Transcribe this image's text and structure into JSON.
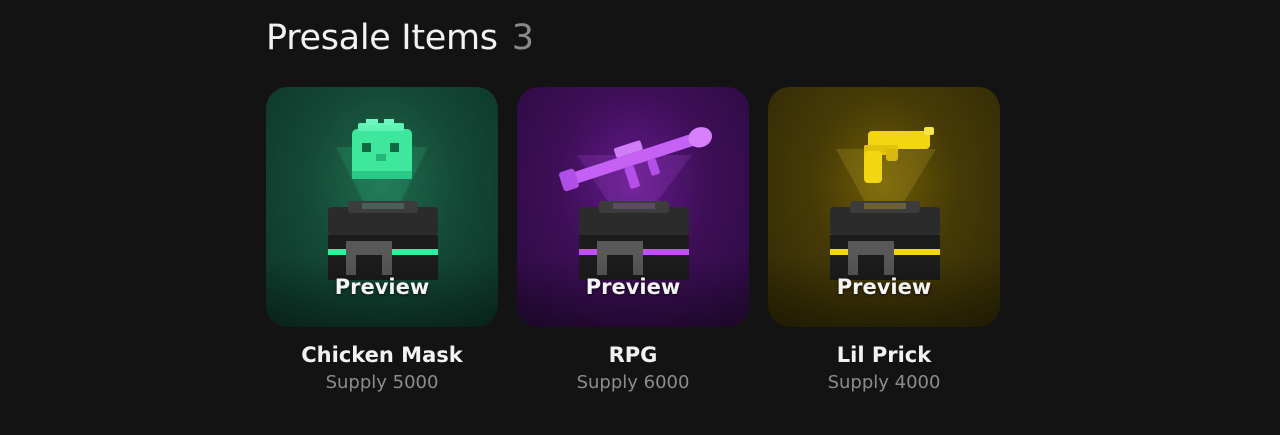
{
  "header": {
    "title": "Presale Items",
    "count": "3"
  },
  "items": [
    {
      "name": "Chicken Mask",
      "supply": "Supply 5000",
      "preview_label": "Preview",
      "icon": "chicken-mask-icon",
      "accent": "#35e29a"
    },
    {
      "name": "RPG",
      "supply": "Supply 6000",
      "preview_label": "Preview",
      "icon": "rocket-launcher-icon",
      "accent": "#c04bf2"
    },
    {
      "name": "Lil Prick",
      "supply": "Supply 4000",
      "preview_label": "Preview",
      "icon": "pistol-icon",
      "accent": "#f2d60f"
    }
  ]
}
